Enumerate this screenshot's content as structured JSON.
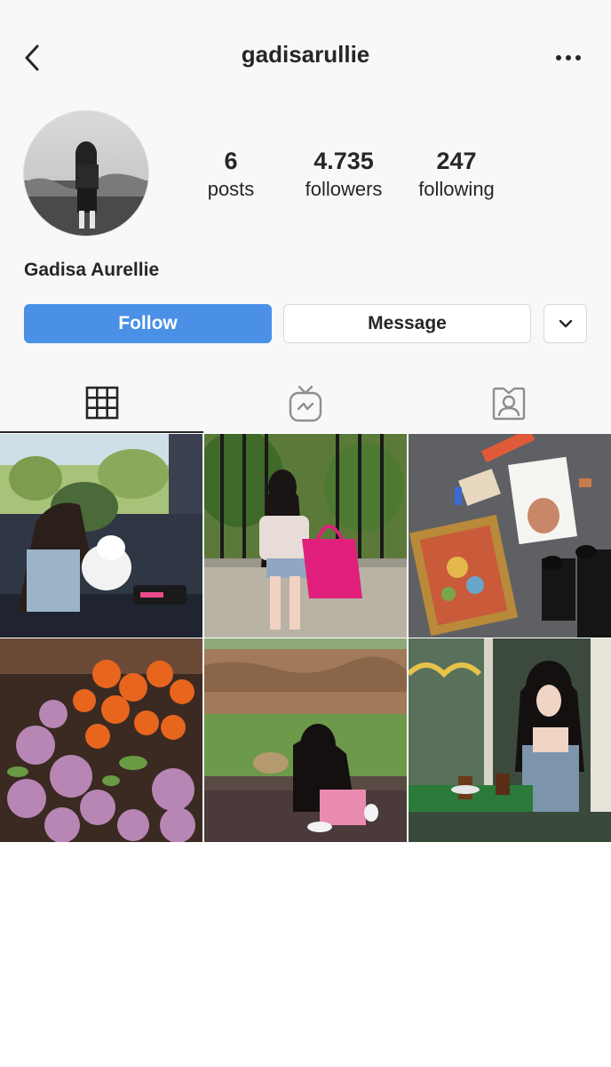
{
  "header": {
    "username": "gadisarullie",
    "back_icon": "chevron-left-icon",
    "more_icon": "more-horizontal-icon"
  },
  "profile": {
    "full_name": "Gadisa Aurellie",
    "stats": {
      "posts": {
        "value": "6",
        "label": "posts"
      },
      "followers": {
        "value": "4.735",
        "label": "followers"
      },
      "following": {
        "value": "247",
        "label": "following"
      }
    }
  },
  "actions": {
    "follow_label": "Follow",
    "message_label": "Message",
    "dropdown_icon": "chevron-down-icon"
  },
  "tabs": [
    {
      "name": "posts-grid",
      "icon": "grid-icon",
      "active": true
    },
    {
      "name": "igtv",
      "icon": "igtv-icon",
      "active": false
    },
    {
      "name": "tagged",
      "icon": "tagged-user-icon",
      "active": false
    }
  ],
  "colors": {
    "accent": "#4a90e6",
    "text": "#262626",
    "background": "#f8f8f9"
  },
  "posts": [
    {
      "icon": "photo-girl-with-dog-in-car"
    },
    {
      "icon": "photo-girl-with-pink-bag"
    },
    {
      "icon": "photo-art-supplies-on-floor"
    },
    {
      "icon": "photo-rose-bouquet"
    },
    {
      "icon": "photo-girl-at-zoo"
    },
    {
      "icon": "photo-girl-at-cafe"
    }
  ]
}
